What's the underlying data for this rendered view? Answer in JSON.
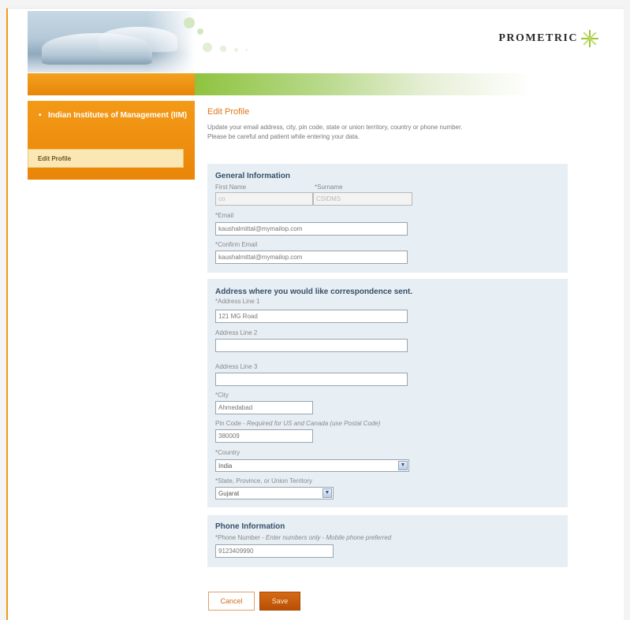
{
  "header": {
    "logo_text": "PROMETRIC"
  },
  "sidebar": {
    "title": "Indian Institutes of Management (IIM)",
    "items": [
      {
        "label": "Edit Profile"
      }
    ]
  },
  "main": {
    "title": "Edit Profile",
    "intro_line1": "Update your email address, city, pin code, state or union territory, country or phone number.",
    "intro_line2": "Please be careful and patient while entering your data."
  },
  "general": {
    "heading": "General Information",
    "first_name_label": "First Name",
    "first_name_value": "co",
    "surname_label": "*Surname",
    "surname_value": "CSIDMS",
    "email_label": "*Email",
    "email_value": "kaushalmittal@mymailop.com",
    "confirm_email_label": "*Confirm Email",
    "confirm_email_value": "kaushalmittal@mymailop.com"
  },
  "address": {
    "heading": "Address where you would like correspondence sent.",
    "line1_label": "*Address Line 1",
    "line1_value": "121 MG Road",
    "line2_label": "Address Line 2",
    "line2_value": "",
    "line3_label": "Address Line 3",
    "line3_value": "",
    "city_label": "*City",
    "city_value": "Ahmedabad",
    "pin_label": "Pin Code - ",
    "pin_note": "Required for US and Canada (use Postal Code)",
    "pin_value": "380009",
    "country_label": "*Country",
    "country_value": "India",
    "state_label": "*State, Province, or Union Territory",
    "state_value": "Gujarat"
  },
  "phone": {
    "heading": "Phone Information",
    "label": "*Phone Number - ",
    "note": "Enter numbers only - Mobile phone preferred",
    "value": "9123409990"
  },
  "actions": {
    "cancel": "Cancel",
    "save": "Save"
  },
  "colors": {
    "accent_orange": "#e8850a",
    "accent_green": "#8fc33f",
    "panel_bg": "#e7eef4",
    "save_button": "#c25a0c"
  },
  "icons": {
    "dropdown": "chevron-down-icon",
    "logo": "starburst-icon"
  }
}
